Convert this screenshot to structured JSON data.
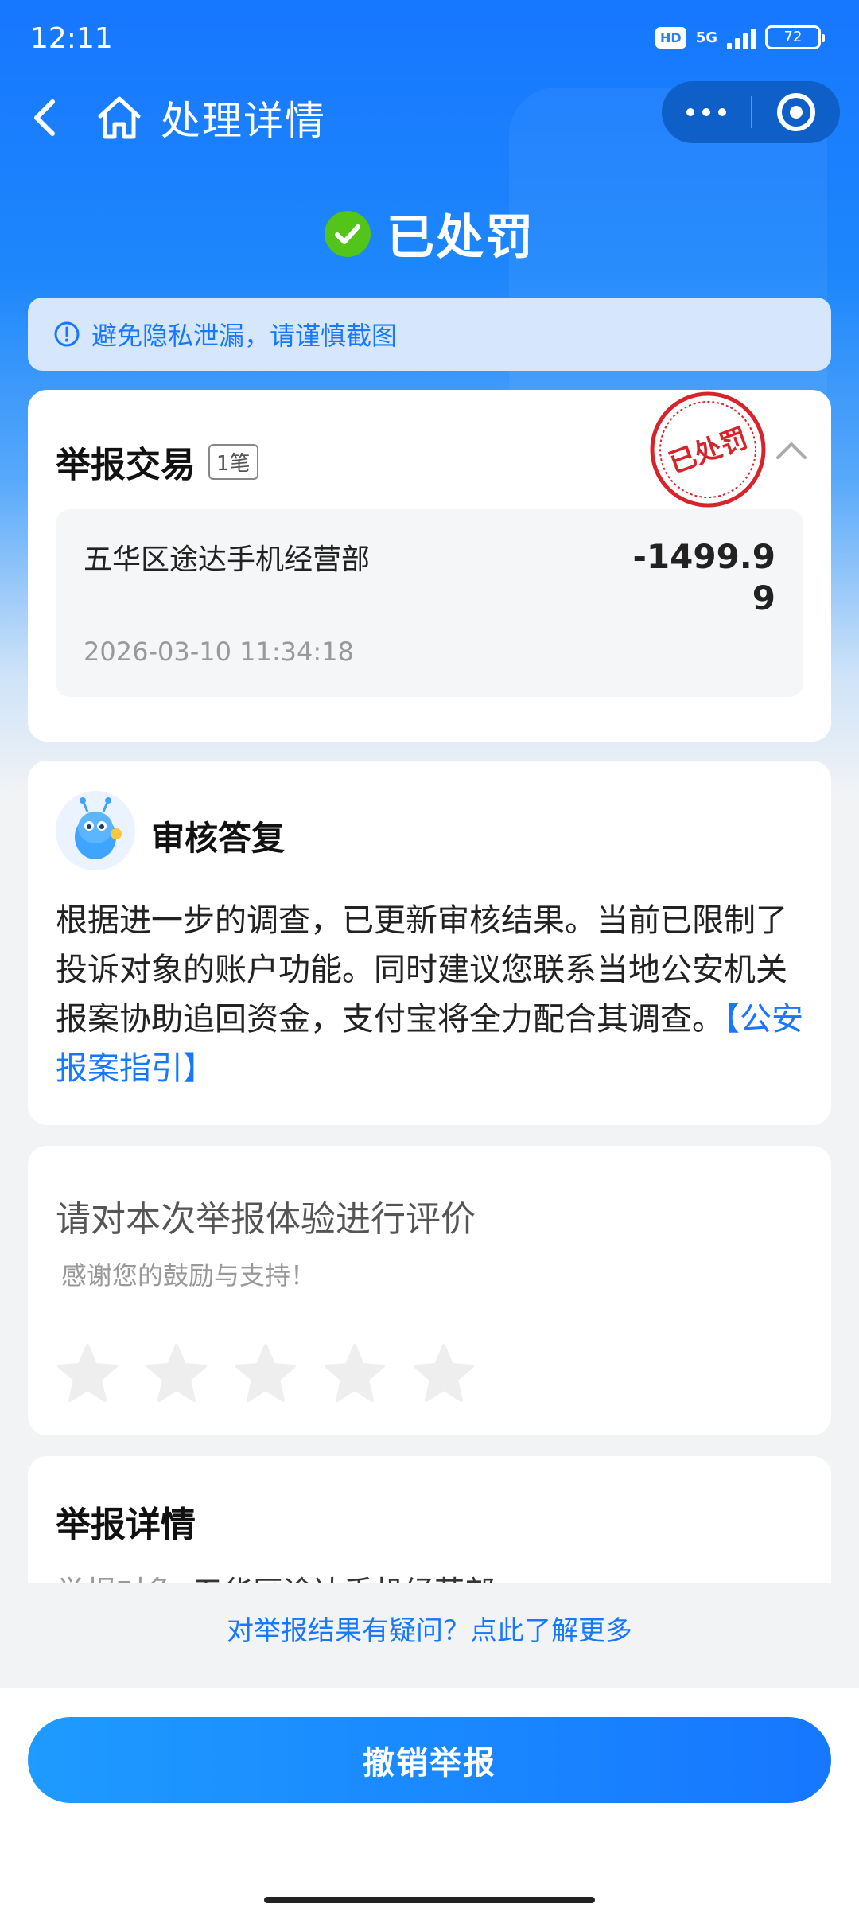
{
  "status_bar": {
    "time": "12:11",
    "hd": "HD",
    "network": "5G",
    "battery": "72"
  },
  "nav": {
    "title": "处理详情",
    "back_icon": "chevron-left-icon",
    "home_icon": "home-icon",
    "more_icon": "more-dots-icon",
    "close_icon": "target-icon"
  },
  "status": {
    "text": "已处罚",
    "icon": "check-circle-icon",
    "icon_color": "#52c41a"
  },
  "notice": {
    "text": "避免隐私泄漏，请谨慎截图",
    "icon": "info-icon"
  },
  "transaction": {
    "title": "举报交易",
    "count": "1笔",
    "stamp_text": "已处罚",
    "stamp_color": "#d8232a",
    "merchant": "五华区途达手机经营部",
    "amount": "-1499.99",
    "date": "2026-03-10 11:34:18"
  },
  "review": {
    "title": "审核答复",
    "body": "根据进一步的调查，已更新审核结果。当前已限制了投诉对象的账户功能。同时建议您联系当地公安机关报案协助追回资金，支付宝将全力配合其调查。",
    "link": "【公安报案指引】"
  },
  "rating": {
    "title": "请对本次举报体验进行评价",
    "subtitle": "感谢您的鼓励与支持！",
    "max_stars": 5,
    "selected": 0
  },
  "detail": {
    "title": "举报详情",
    "peek_label": "举报对象",
    "peek_value": "五华区途达手机经营部"
  },
  "question_link": "对举报结果有疑问？点此了解更多",
  "cancel_button": "撤销举报",
  "colors": {
    "primary": "#1677ff",
    "stamp": "#d8232a",
    "success": "#52c41a"
  }
}
